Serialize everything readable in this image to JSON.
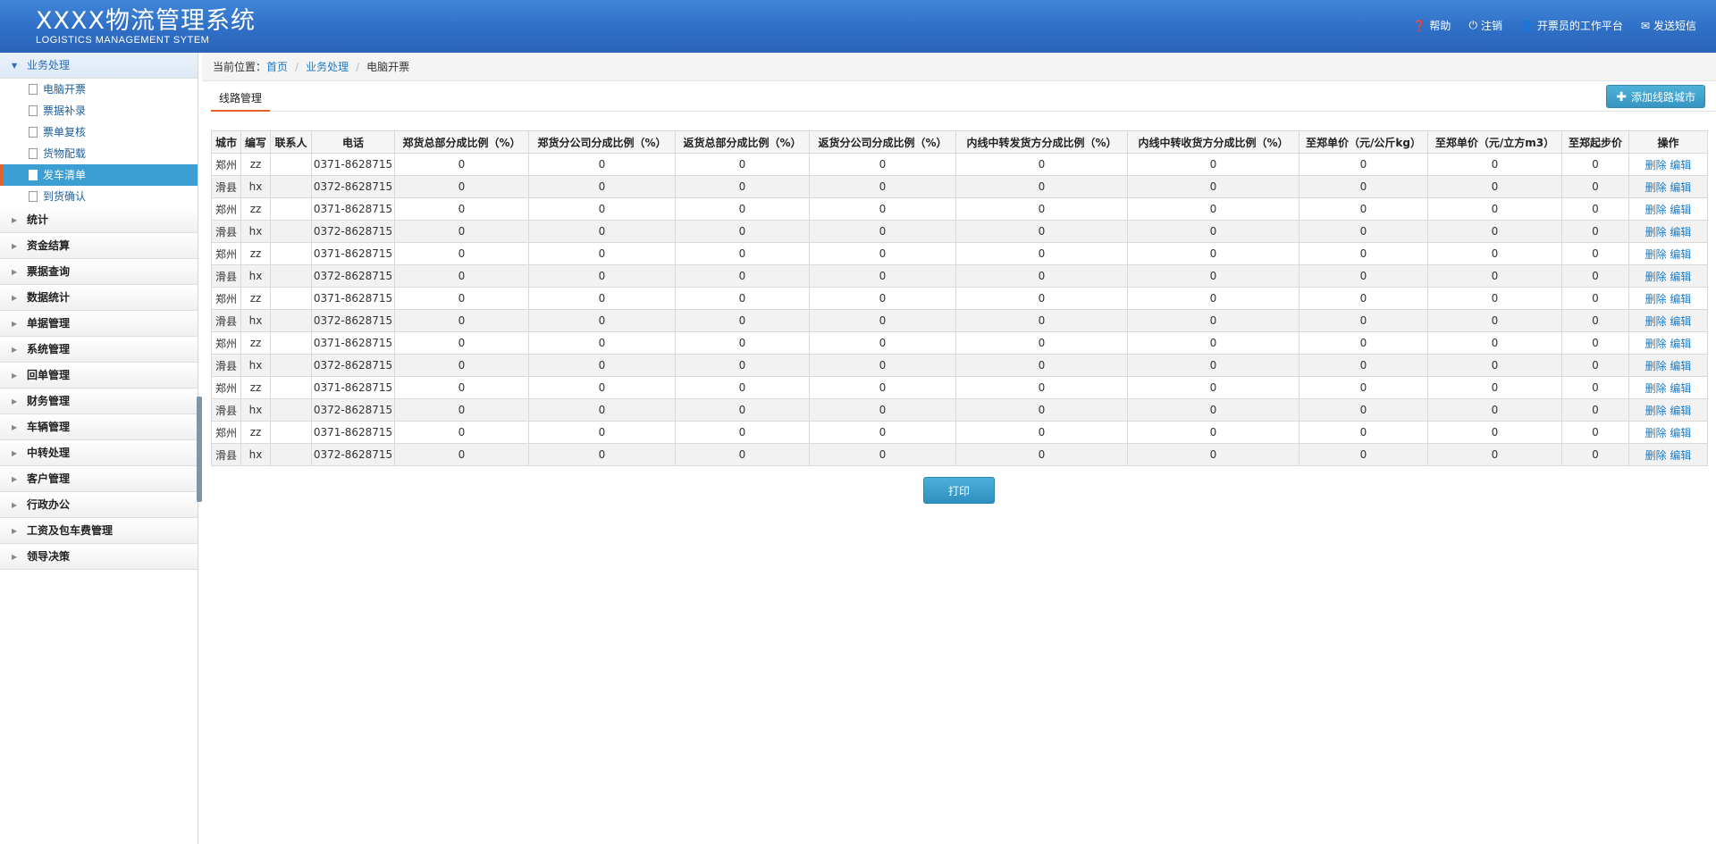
{
  "header": {
    "title": "XXXX物流管理系统",
    "subtitle": "LOGISTICS MANAGEMENT SYTEM",
    "links": [
      {
        "icon": "help-icon",
        "label": "帮助"
      },
      {
        "icon": "power-icon",
        "label": "注销"
      },
      {
        "icon": "user-icon",
        "label": "开票员的工作平台"
      },
      {
        "icon": "mail-icon",
        "label": "发送短信"
      }
    ]
  },
  "sidebar": {
    "open_group": "业务处理",
    "subitems": [
      "电脑开票",
      "票据补录",
      "票单复核",
      "货物配载",
      "发车清单",
      "到货确认"
    ],
    "active_index": 4,
    "groups": [
      "统计",
      "资金结算",
      "票据查询",
      "数据统计",
      "单据管理",
      "系统管理",
      "回单管理",
      "财务管理",
      "车辆管理",
      "中转处理",
      "客户管理",
      "行政办公",
      "工资及包车费管理",
      "领导决策"
    ]
  },
  "breadcrumb": {
    "prefix": "当前位置：",
    "home": "首页",
    "section": "业务处理",
    "current": "电脑开票"
  },
  "tab": {
    "label": "线路管理"
  },
  "add_button": {
    "label": "添加线路城市"
  },
  "table": {
    "headers": [
      "城市",
      "编写",
      "联系人",
      "电话",
      "郑货总部分成比例（%）",
      "郑货分公司分成比例（%）",
      "返货总部分成比例（%）",
      "返货分公司分成比例（%）",
      "内线中转发货方分成比例（%）",
      "内线中转收货方分成比例（%）",
      "至郑单价（元/公斤kg）",
      "至郑单价（元/立方m3）",
      "至郑起步价",
      "操作"
    ],
    "rows": [
      [
        "郑州",
        "zz",
        "",
        "0371-8628715",
        "0",
        "0",
        "0",
        "0",
        "0",
        "0",
        "0",
        "0",
        "0"
      ],
      [
        "滑县",
        "hx",
        "",
        "0372-8628715",
        "0",
        "0",
        "0",
        "0",
        "0",
        "0",
        "0",
        "0",
        "0"
      ],
      [
        "郑州",
        "zz",
        "",
        "0371-8628715",
        "0",
        "0",
        "0",
        "0",
        "0",
        "0",
        "0",
        "0",
        "0"
      ],
      [
        "滑县",
        "hx",
        "",
        "0372-8628715",
        "0",
        "0",
        "0",
        "0",
        "0",
        "0",
        "0",
        "0",
        "0"
      ],
      [
        "郑州",
        "zz",
        "",
        "0371-8628715",
        "0",
        "0",
        "0",
        "0",
        "0",
        "0",
        "0",
        "0",
        "0"
      ],
      [
        "滑县",
        "hx",
        "",
        "0372-8628715",
        "0",
        "0",
        "0",
        "0",
        "0",
        "0",
        "0",
        "0",
        "0"
      ],
      [
        "郑州",
        "zz",
        "",
        "0371-8628715",
        "0",
        "0",
        "0",
        "0",
        "0",
        "0",
        "0",
        "0",
        "0"
      ],
      [
        "滑县",
        "hx",
        "",
        "0372-8628715",
        "0",
        "0",
        "0",
        "0",
        "0",
        "0",
        "0",
        "0",
        "0"
      ],
      [
        "郑州",
        "zz",
        "",
        "0371-8628715",
        "0",
        "0",
        "0",
        "0",
        "0",
        "0",
        "0",
        "0",
        "0"
      ],
      [
        "滑县",
        "hx",
        "",
        "0372-8628715",
        "0",
        "0",
        "0",
        "0",
        "0",
        "0",
        "0",
        "0",
        "0"
      ],
      [
        "郑州",
        "zz",
        "",
        "0371-8628715",
        "0",
        "0",
        "0",
        "0",
        "0",
        "0",
        "0",
        "0",
        "0"
      ],
      [
        "滑县",
        "hx",
        "",
        "0372-8628715",
        "0",
        "0",
        "0",
        "0",
        "0",
        "0",
        "0",
        "0",
        "0"
      ],
      [
        "郑州",
        "zz",
        "",
        "0371-8628715",
        "0",
        "0",
        "0",
        "0",
        "0",
        "0",
        "0",
        "0",
        "0"
      ],
      [
        "滑县",
        "hx",
        "",
        "0372-8628715",
        "0",
        "0",
        "0",
        "0",
        "0",
        "0",
        "0",
        "0",
        "0"
      ]
    ],
    "action_delete": "删除",
    "action_edit": "编辑"
  },
  "print_button": {
    "label": "打印"
  }
}
